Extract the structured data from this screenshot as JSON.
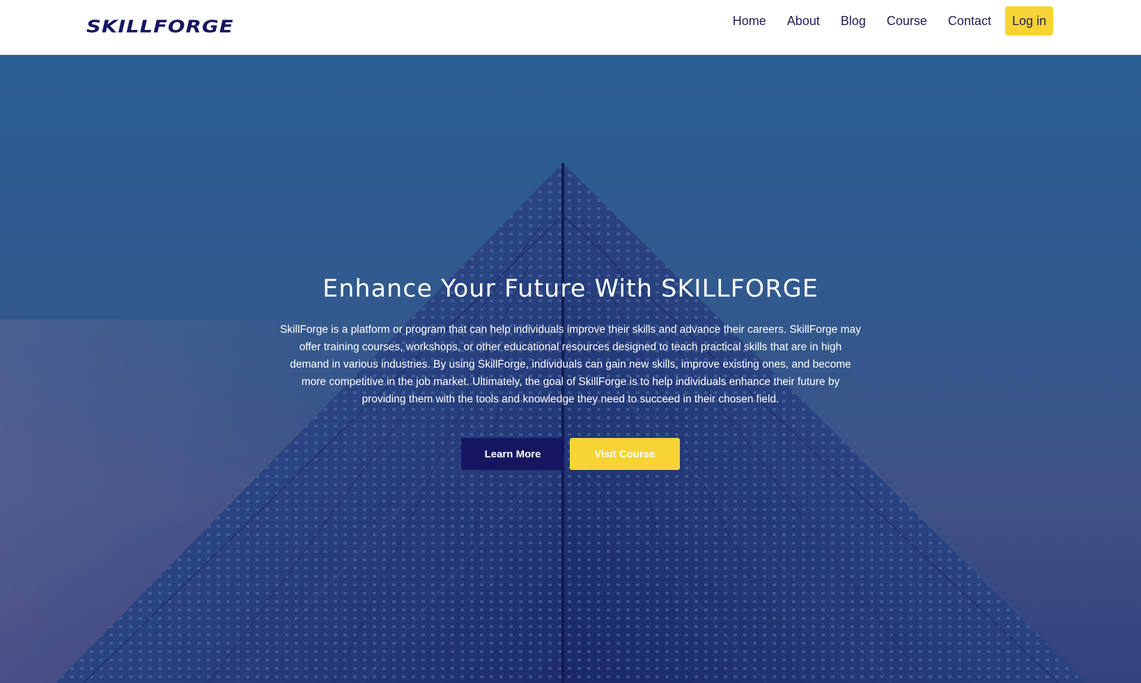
{
  "nav": {
    "logo_text": "SKILLFORGE",
    "links": [
      "Home",
      "About",
      "Blog",
      "Course",
      "Contact"
    ],
    "login_label": "Log in"
  },
  "hero": {
    "title": "Enhance Your Future With SKILLFORGE",
    "description": "SkillForge is a platform or program that can help individuals improve their skills and advance their careers. SkillForge may offer training courses, workshops, or other educational resources designed to teach practical skills that are in high demand in various industries. By using SkillForge, individuals can gain new skills, improve existing ones, and become more competitive in the job market. Ultimately, the goal of SkillForge is to help individuals enhance their future by providing them with the tools and knowledge they need to succeed in their chosen field.",
    "learn_more_label": "Learn More",
    "visit_course_label": "Visit Course",
    "background_image": "glass-pyramid-building"
  },
  "colors": {
    "brand_navy": "#161660",
    "accent_yellow": "#f7d335",
    "hero_blue": "#2d5f96"
  }
}
